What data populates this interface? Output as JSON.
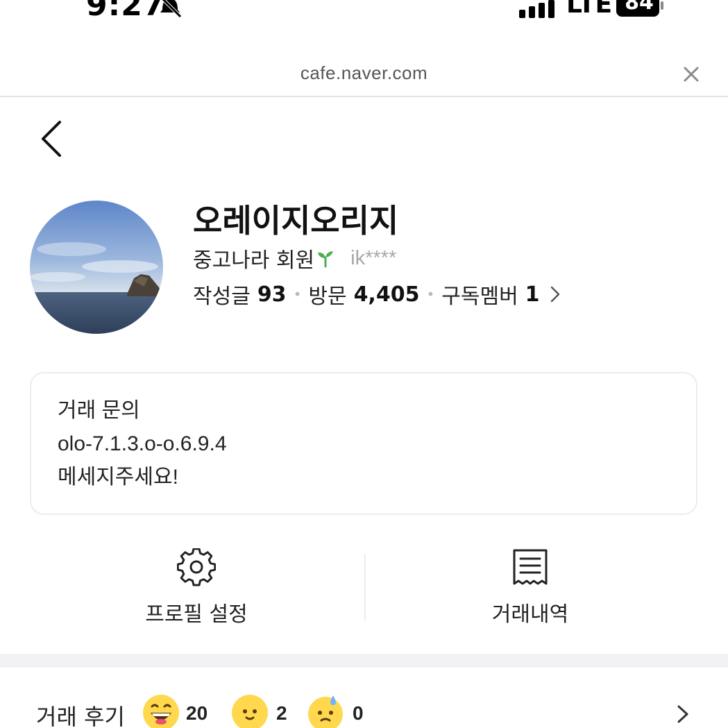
{
  "status_bar": {
    "time": "9:27",
    "network": "LTE",
    "battery": "84"
  },
  "browser": {
    "url": "cafe.naver.com"
  },
  "profile": {
    "nickname": "오레이지오리지",
    "member_level": "중고나라 회원",
    "member_id": "ik****",
    "stats": {
      "posts_label": "작성글",
      "posts_value": "93",
      "visits_label": "방문",
      "visits_value": "4,405",
      "subscribers_label": "구독멤버",
      "subscribers_value": "1"
    }
  },
  "intro": {
    "lines": [
      "거래 문의",
      "olo-7.1.3.o-o.6.9.4",
      "메세지주세요!"
    ]
  },
  "actions": {
    "profile_settings": "프로필 설정",
    "trade_history": "거래내역"
  },
  "reviews": {
    "label": "거래 후기",
    "good_count": "20",
    "neutral_count": "2",
    "bad_count": "0"
  },
  "colors": {
    "sprout": "#4caf50",
    "emoji_yellow": "#ffd84d",
    "divider": "#ececec",
    "band": "#f2f2f4"
  }
}
